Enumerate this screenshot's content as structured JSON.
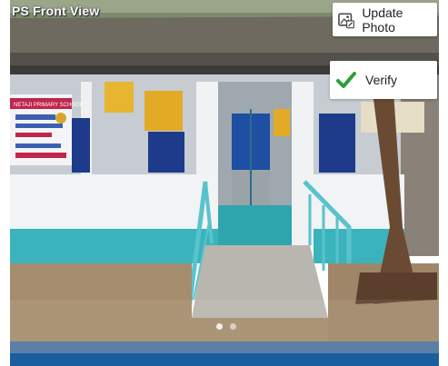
{
  "photo": {
    "title": "PS Front View",
    "sign_text": "NETAJI PRIMARY SCHOOL",
    "carousel_dots": 2,
    "active_dot_index": 0
  },
  "actions": {
    "update_photo_label": "Update Photo",
    "verify_label": "Verify"
  },
  "colors": {
    "verify_check": "#2e9e3a",
    "bottom_bar_top": "#5b7fa6",
    "bottom_bar_bottom": "#1b5ea0",
    "wall_teal": "#3bb3bd"
  }
}
